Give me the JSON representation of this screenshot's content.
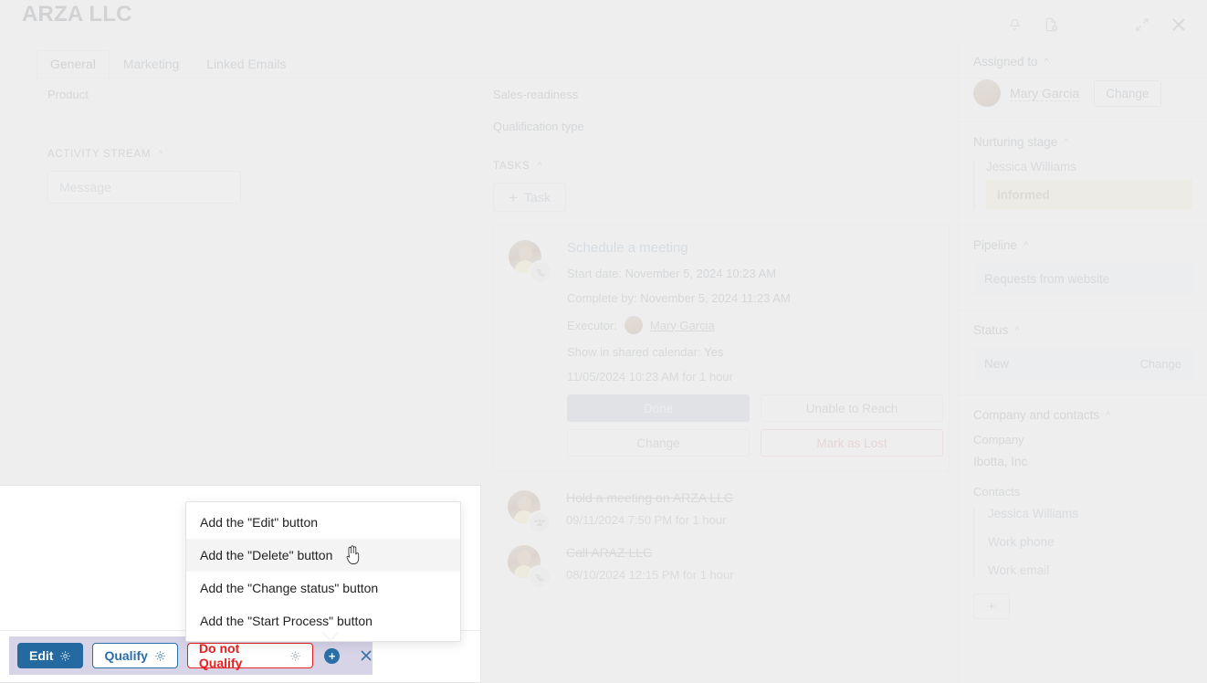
{
  "window": {
    "title": "ARZA LLC",
    "icons": [
      {
        "name": "bell-icon",
        "glyph": "•"
      },
      {
        "name": "document-add-icon",
        "glyph": "•"
      },
      {
        "name": "expand-icon",
        "glyph": "•"
      },
      {
        "name": "close-icon",
        "glyph": "✕"
      }
    ]
  },
  "tabs": [
    {
      "label": "General",
      "active": true
    },
    {
      "label": "Marketing",
      "active": false
    },
    {
      "label": "Linked Emails",
      "active": false
    }
  ],
  "left": {
    "product_label": "Product",
    "activity_stream_label": "ACTIVITY STREAM",
    "message_placeholder": "Message"
  },
  "middle": {
    "sales_readiness_label": "Sales-readiness",
    "qualification_type_label": "Qualification type",
    "tasks_label": "TASKS",
    "add_task_label": "Task",
    "task": {
      "title": "Schedule a meeting",
      "start_date_label": "Start date:",
      "start_date_value": "November 5, 2024 10:23 AM",
      "complete_by_label": "Complete by:",
      "complete_by_value": "November 5, 2024 11:23 AM",
      "executor_label": "Executor:",
      "executor_name": "Mary Garcia",
      "shared_calendar_label": "Show in shared calendar:",
      "shared_calendar_value": "Yes",
      "schedule_line": "11/05/2024 10:23 AM for 1 hour",
      "buttons": [
        {
          "label": "Done",
          "style": "primary"
        },
        {
          "label": "Unable to Reach",
          "style": "default"
        },
        {
          "label": "Change",
          "style": "default"
        },
        {
          "label": "Mark as Lost",
          "style": "danger"
        }
      ]
    },
    "completed_tasks": [
      {
        "title": "Hold a meeting on ARZA LLC",
        "date": "09/11/2024 7:50 PM for 1 hour",
        "icon": "group-icon"
      },
      {
        "title": "Call ARAZ LLC",
        "date": "08/10/2024 12:15 PM for 1 hour",
        "icon": "phone-icon"
      }
    ]
  },
  "sidebar": {
    "assigned": {
      "title": "Assigned to",
      "name": "Mary Garcia",
      "change_label": "Change"
    },
    "nurturing": {
      "title": "Nurturing stage",
      "contact": "Jessica Williams",
      "stage": "Informed",
      "stage_color": "#ece4d3"
    },
    "pipeline": {
      "title": "Pipeline",
      "value": "Requests from website"
    },
    "status": {
      "title": "Status",
      "value": "New",
      "change_label": "Change"
    },
    "company_contacts": {
      "title": "Company and contacts",
      "company_label": "Company",
      "company_value": "Ibotta, Inc",
      "contacts_label": "Contacts",
      "contacts": [
        "Jessica Williams",
        "Work phone",
        "Work email"
      ],
      "add_label": "+"
    }
  },
  "toolbar": {
    "edit_label": "Edit",
    "qualify_label": "Qualify",
    "do_not_qualify_label": "Do not Qualify",
    "add_label": "+",
    "close_label": "✕",
    "background_color": "#d7d4e8",
    "edit_color": "#24699f",
    "qualify_color": "#2a6fa8",
    "danger_color": "#e82121"
  },
  "dropdown": {
    "items": [
      {
        "label": "Add the \"Edit\" button",
        "hover": false
      },
      {
        "label": "Add the \"Delete\" button",
        "hover": true
      },
      {
        "label": "Add the \"Change status\" button",
        "hover": false
      },
      {
        "label": "Add the \"Start Process\" button",
        "hover": false
      }
    ]
  }
}
